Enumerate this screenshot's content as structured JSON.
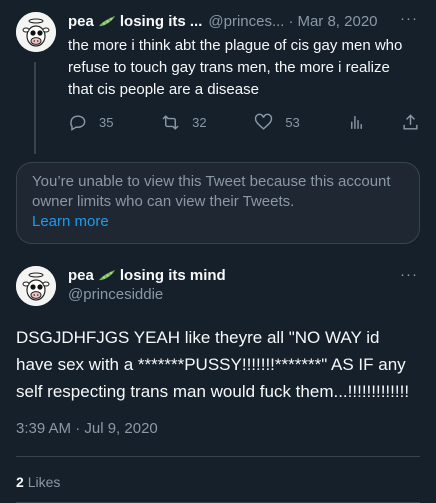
{
  "tweet1": {
    "name": "pea",
    "name_rest": "losing its ...",
    "handle": "@princes...",
    "dot": "·",
    "date": "Mar 8, 2020",
    "more": "···",
    "body": "the more i think abt the plague of cis gay men who refuse to touch gay trans men, the more i realize that cis people are a disease",
    "reply_count": "35",
    "retweet_count": "32",
    "like_count": "53"
  },
  "unavailable": {
    "message": "You’re unable to view this Tweet because this account owner limits who can view their Tweets.",
    "link": "Learn more"
  },
  "tweet2": {
    "name": "pea",
    "name_rest": "losing its mind",
    "handle": "@princesiddie",
    "more": "···",
    "body": "DSGJDHFJGS YEAH like theyre all \"NO WAY id have sex with a *******PUSSY!!!!!!!*******\" AS IF any self respecting trans man would fuck them...!!!!!!!!!!!!!",
    "timestamp": "3:39 AM · Jul 9, 2020",
    "likes_count": "2",
    "likes_label": "Likes"
  },
  "colors": {
    "background": "#15202b",
    "text": "#f7f9f9",
    "muted": "#8b98a5",
    "link": "#1d9bf0",
    "border": "#38444d"
  },
  "icons": [
    "reply-icon",
    "retweet-icon",
    "like-icon",
    "analytics-icon",
    "share-icon",
    "pea-pod-icon",
    "more-icon"
  ]
}
